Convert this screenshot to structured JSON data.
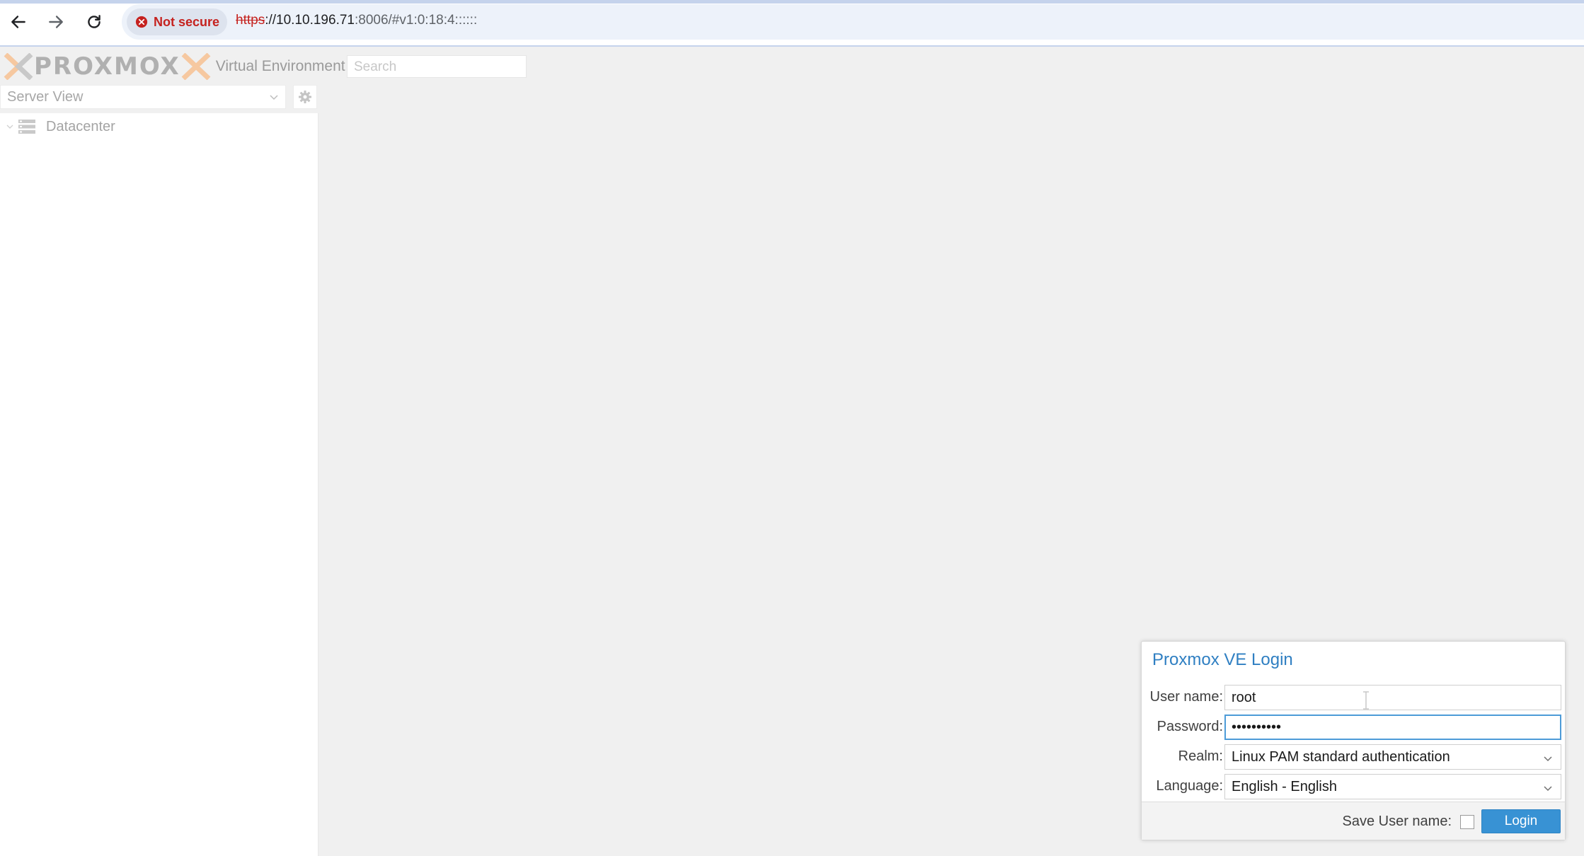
{
  "browser": {
    "security_label": "Not secure",
    "url_scheme": "https",
    "url_host": "://10.10.196.71",
    "url_rest": ":8006/#v1:0:18:4::::::"
  },
  "header": {
    "logo_text": "PROXMOX",
    "logo_subtitle": "Virtual Environment",
    "search_placeholder": "Search"
  },
  "sidebar": {
    "view_selector": "Server View",
    "tree": [
      {
        "label": "Datacenter",
        "icon": "datacenter-icon"
      }
    ]
  },
  "login": {
    "title": "Proxmox VE Login",
    "username_label": "User name:",
    "username_value": "root",
    "password_label": "Password:",
    "password_value": "••••••••••",
    "realm_label": "Realm:",
    "realm_value": "Linux PAM standard authentication",
    "language_label": "Language:",
    "language_value": "English - English",
    "save_username_label": "Save User name:",
    "save_username_checked": false,
    "login_button": "Login"
  },
  "colors": {
    "accent": "#3892d4",
    "title_blue": "#2f7fc2",
    "insecure_red": "#c5221f",
    "logo_orange": "#f6c8a0"
  }
}
